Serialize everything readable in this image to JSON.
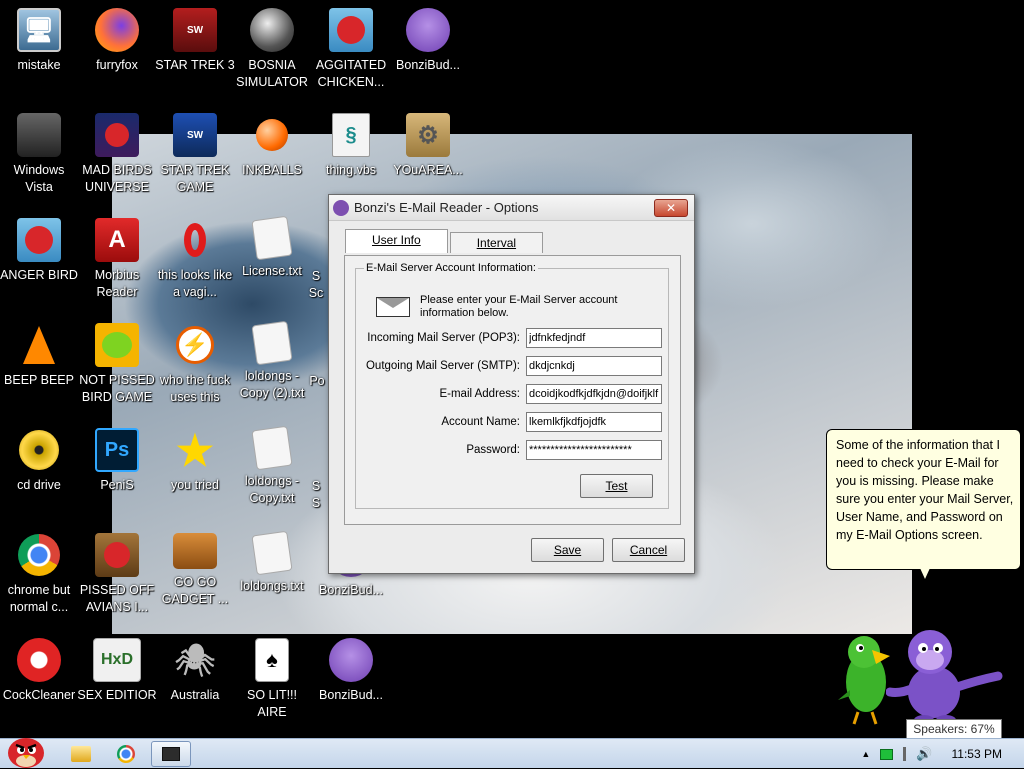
{
  "desktop": {
    "icons": [
      {
        "label": "mistake",
        "icon": "computer-icon"
      },
      {
        "label": "furryfox",
        "icon": "firefox-icon"
      },
      {
        "label": "STAR TREK 3",
        "icon": "star-wars-game-icon"
      },
      {
        "label": "BOSNIA SIMULATOR",
        "icon": "mine-icon"
      },
      {
        "label": "AGGITATED CHICKEN...",
        "icon": "angry-bird-icon"
      },
      {
        "label": "BonziBud...",
        "icon": "bonzi-icon"
      },
      {
        "label": "Windows Vista",
        "icon": "trash-icon"
      },
      {
        "label": "MAD BIRDS UNIVERSE",
        "icon": "angry-birds-space-icon"
      },
      {
        "label": "STAR TREK GAME",
        "icon": "star-wars-game-icon"
      },
      {
        "label": "INKBALLS",
        "icon": "inkball-icon"
      },
      {
        "label": "thing.vbs",
        "icon": "script-file-icon"
      },
      {
        "label": "YOuAREA...",
        "icon": "gear-folder-icon"
      },
      {
        "label": "ANGER BIRD",
        "icon": "angry-bird-icon"
      },
      {
        "label": "Morbius Reader",
        "icon": "acrobat-icon"
      },
      {
        "label": "this looks like a vagi...",
        "icon": "opera-icon"
      },
      {
        "label": "License.txt",
        "icon": "text-file-icon"
      },
      {
        "label": "BEEP BEEP",
        "icon": "vlc-icon"
      },
      {
        "label": "NOT PISSED BIRD GAME",
        "icon": "pig-icon"
      },
      {
        "label": "who the fuck uses this",
        "icon": "winamp-icon"
      },
      {
        "label": "loldongs - Copy (2).txt",
        "icon": "text-file-icon"
      },
      {
        "label": "cd drive",
        "icon": "cd-icon"
      },
      {
        "label": "PeniS",
        "icon": "photoshop-icon"
      },
      {
        "label": "you tried",
        "icon": "star-icon"
      },
      {
        "label": "loldongs - Copy.txt",
        "icon": "text-file-icon"
      },
      {
        "label": "chrome but normal c...",
        "icon": "chrome-icon"
      },
      {
        "label": "PISSED OFF AVIANS I...",
        "icon": "angry-birds-seasons-icon"
      },
      {
        "label": "GO GO GADGET ...",
        "icon": "briefcase-icon"
      },
      {
        "label": "loldongs.txt",
        "icon": "text-file-icon"
      },
      {
        "label": "BonziBud...",
        "icon": "bonzi-icon"
      },
      {
        "label": "CockCleaner",
        "icon": "ccleaner-icon"
      },
      {
        "label": "SEX EDITIOR",
        "icon": "hxd-icon"
      },
      {
        "label": "Australia",
        "icon": "spider-solitaire-icon"
      },
      {
        "label": "SO LIT!!! AIRE",
        "icon": "solitaire-icon"
      },
      {
        "label": "BonziBud...",
        "icon": "bonzi-icon"
      }
    ],
    "partial_labels": [
      "S",
      "Sc",
      "Po",
      "S",
      "S"
    ]
  },
  "dialog": {
    "title": "Bonzi's E-Mail Reader - Options",
    "close_label": "✕",
    "tabs": [
      "User Info",
      "Interval"
    ],
    "group_title": "E-Mail Server Account Information:",
    "info_text": "Please enter your E-Mail Server account information below.",
    "fields": [
      {
        "label": "Incoming Mail Server (POP3):",
        "value": "jdfnkfedjndf"
      },
      {
        "label": "Outgoing Mail Server (SMTP):",
        "value": "dkdjcnkdj"
      },
      {
        "label": "E-mail Address:",
        "value": "dcoidjkodfkjdfkjdn@doifjklf"
      },
      {
        "label": "Account Name:",
        "value": "lkemlkfjkdfjojdfk"
      },
      {
        "label": "Password:",
        "value": "************************"
      }
    ],
    "test_label": "Test",
    "save_label": "Save",
    "cancel_label": "Cancel"
  },
  "balloon": {
    "text": "Some of the information that I need to check your E-Mail for you is missing. Please make sure you enter your Mail Server, User Name, and Password on my E-Mail Options screen."
  },
  "tooltip": {
    "text": "Speakers: 67%"
  },
  "taskbar": {
    "items": [
      "start-icon",
      "explorer-icon",
      "chrome-icon",
      "bonzi-mail-icon"
    ],
    "tray": {
      "clock": "11:53 PM",
      "show_hidden": "▲"
    }
  }
}
